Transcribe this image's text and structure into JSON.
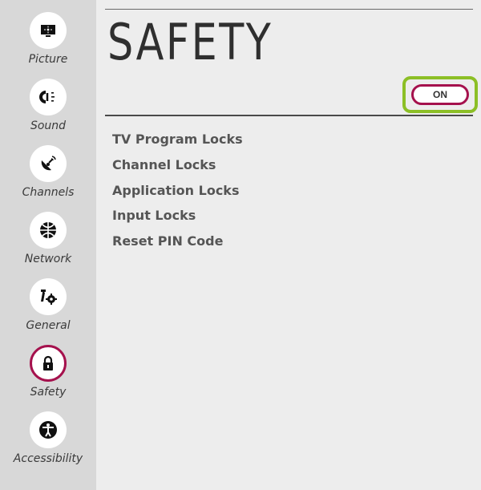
{
  "sidebar": {
    "items": [
      {
        "label": "Picture",
        "icon": "picture-icon",
        "active": false
      },
      {
        "label": "Sound",
        "icon": "sound-icon",
        "active": false
      },
      {
        "label": "Channels",
        "icon": "channels-icon",
        "active": false
      },
      {
        "label": "Network",
        "icon": "network-icon",
        "active": false
      },
      {
        "label": "General",
        "icon": "general-icon",
        "active": false
      },
      {
        "label": "Safety",
        "icon": "lock-icon",
        "active": true
      },
      {
        "label": "Accessibility",
        "icon": "accessibility-icon",
        "active": false
      }
    ]
  },
  "main": {
    "title": "SAFETY",
    "toggle": {
      "label": "ON"
    },
    "menu": [
      {
        "label": "TV Program Locks"
      },
      {
        "label": "Channel Locks"
      },
      {
        "label": "Application Locks"
      },
      {
        "label": "Input Locks"
      },
      {
        "label": "Reset PIN Code"
      }
    ]
  },
  "colors": {
    "accent": "#a5114d",
    "highlight": "#8cbf26",
    "sidebar_bg": "#d8d8d8",
    "main_bg": "#ededed"
  }
}
